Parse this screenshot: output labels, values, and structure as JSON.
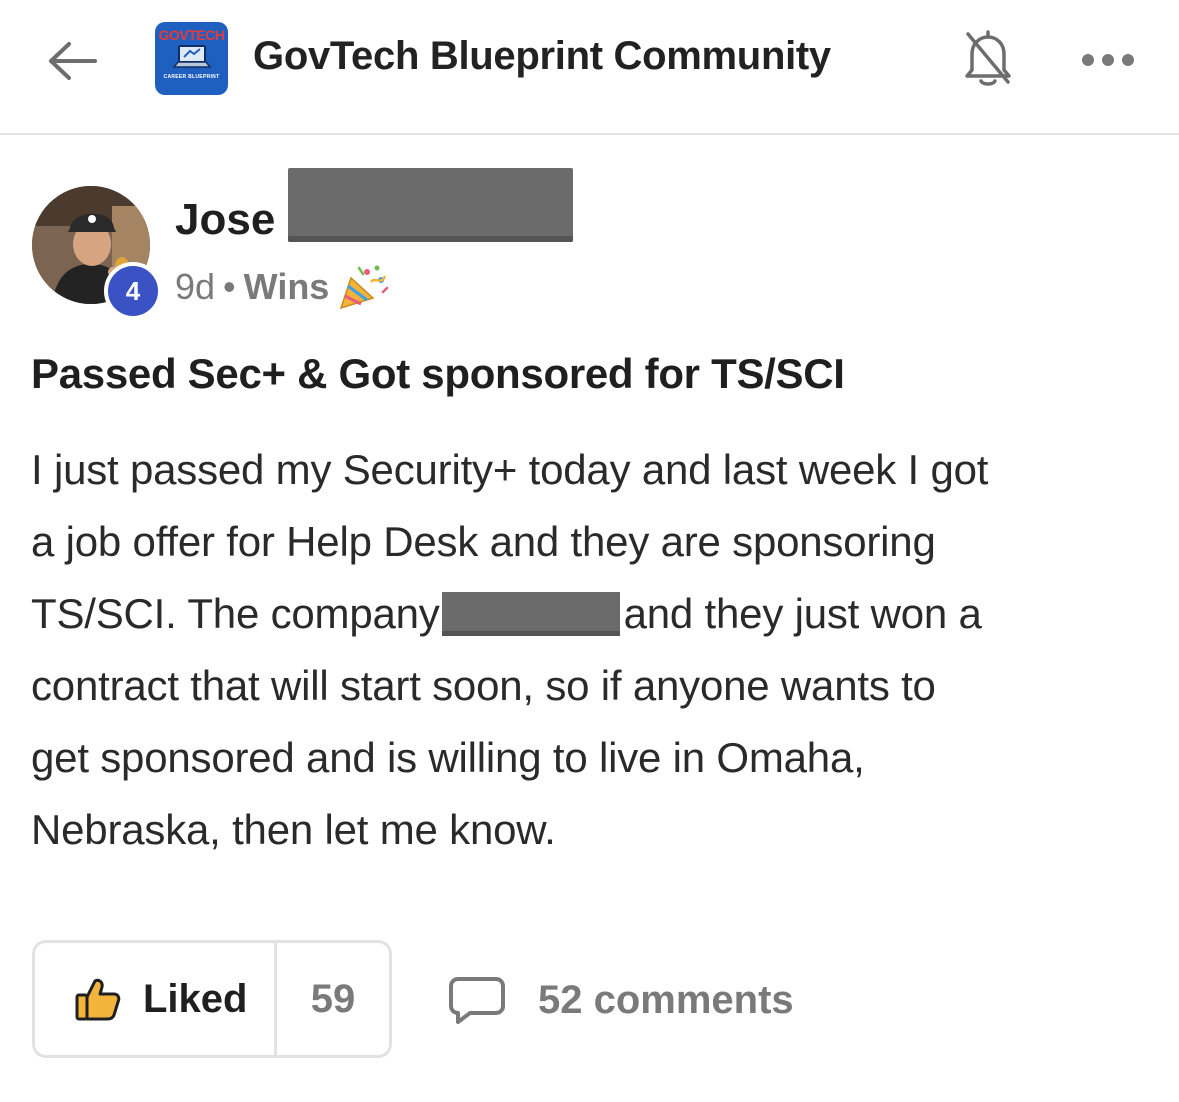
{
  "header": {
    "group_name": "GovTech Blueprint Community",
    "logo_text_top": "GOVTECH",
    "logo_text_bottom": "CAREER BLUEPRINT"
  },
  "post": {
    "author_first_name": "Jose",
    "author_level": "4",
    "age": "9d",
    "separator": "•",
    "category": "Wins",
    "title": "Passed Sec+ & Got sponsored for TS/SCI",
    "body_lines": [
      "I just passed my Security+ today and last week I got",
      "a job offer for Help Desk and they are sponsoring",
      "contract that will start soon, so if anyone wants to",
      "get sponsored and is willing to live in Omaha,",
      "Nebraska, then let me know."
    ],
    "body_line3_before_redaction": "TS/SCI. The company",
    "body_line3_after_redaction": "and they just won a"
  },
  "actions": {
    "like_label": "Liked",
    "like_count": "59",
    "comments_label": "52 comments"
  },
  "icons": {
    "back": "arrow-left-icon",
    "bell": "bell-off-icon",
    "more": "more-horizontal-icon",
    "party": "party-popper-icon",
    "like": "thumbs-up-icon",
    "comment": "comment-bubble-icon"
  },
  "colors": {
    "level_badge": "#3a52c4",
    "logo_background": "#1f5fbf",
    "logo_text": "#e63a3a",
    "muted_text": "#7a7a7a",
    "redaction": "#6b6b6b"
  }
}
